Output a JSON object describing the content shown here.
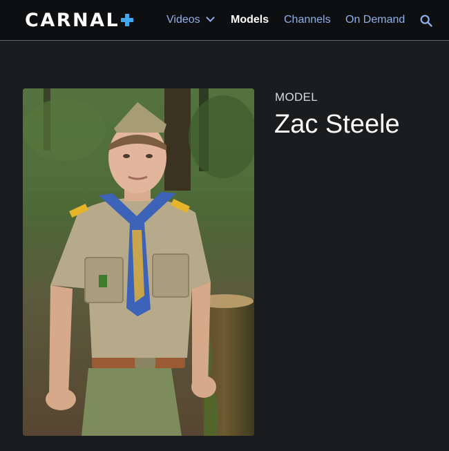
{
  "header": {
    "brand": "CARNAL",
    "brand_mark_icon": "blue-plus-mark",
    "nav": [
      {
        "label": "Videos",
        "has_dropdown": true,
        "active": false
      },
      {
        "label": "Models",
        "has_dropdown": false,
        "active": true
      },
      {
        "label": "Channels",
        "has_dropdown": false,
        "active": false
      },
      {
        "label": "On Demand",
        "has_dropdown": false,
        "active": false
      }
    ],
    "search_icon": "search-icon"
  },
  "profile": {
    "kicker": "MODEL",
    "name": "Zac Steele",
    "photo_description_icon": "model-photo"
  },
  "colors": {
    "background": "#1b1c1e",
    "header_background": "#0e0f10",
    "nav_link": "#8fb0ea",
    "brand_accent": "#3fa8f0"
  }
}
